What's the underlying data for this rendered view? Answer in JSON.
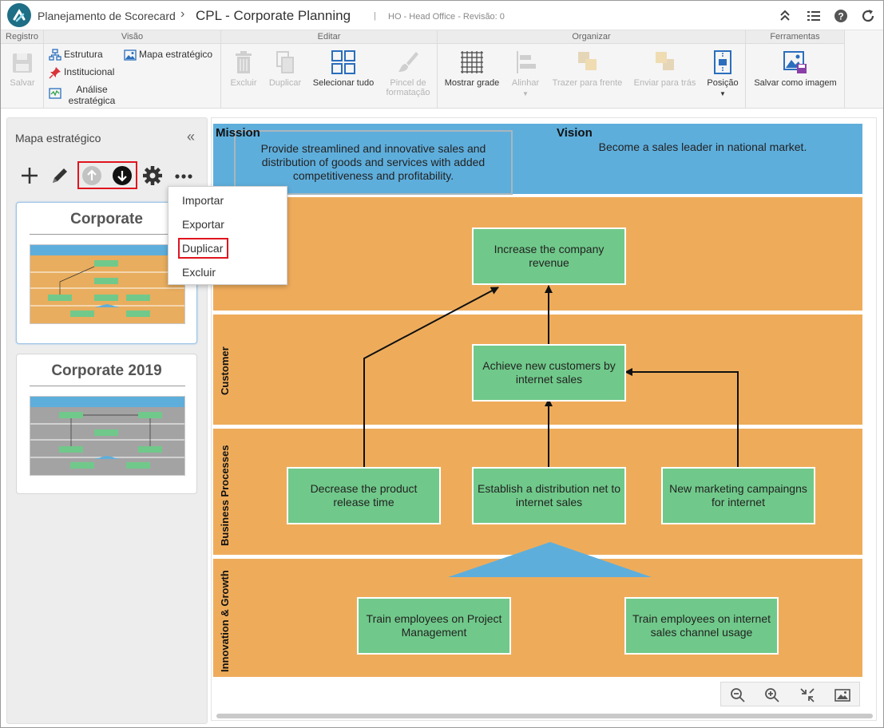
{
  "header": {
    "app_title": "Planejamento de Scorecard",
    "separator": "›",
    "page_title": "CPL - Corporate Planning",
    "meta_separator": "|",
    "meta": "HO - Head Office - Revisão: 0",
    "icons": [
      "collapse-up-icon",
      "list-icon",
      "help-icon",
      "refresh-icon"
    ]
  },
  "ribbon": {
    "groups": {
      "registro": "Registro",
      "visao": "Visão",
      "editar": "Editar",
      "organizar": "Organizar",
      "ferramentas": "Ferramentas"
    },
    "buttons": {
      "salvar": "Salvar",
      "estrutura": "Estrutura",
      "institucional": "Institucional",
      "analise_line1": "Análise",
      "analise_line2": "estratégica",
      "mapa": "Mapa estratégico",
      "excluir": "Excluir",
      "duplicar": "Duplicar",
      "selecionar": "Selecionar tudo",
      "pincel_line1": "Pincel de",
      "pincel_line2": "formatação",
      "mostrar": "Mostrar grade",
      "alinhar": "Alinhar",
      "trazer": "Trazer para frente",
      "enviar": "Enviar para trás",
      "posicao": "Posição",
      "salvar_imagem": "Salvar como imagem"
    }
  },
  "left_panel": {
    "title": "Mapa estratégico",
    "collapse": "«",
    "cards": [
      {
        "title": "Corporate"
      },
      {
        "title": "Corporate 2019"
      }
    ]
  },
  "menu": {
    "items": [
      "Importar",
      "Exportar",
      "Duplicar",
      "Excluir"
    ]
  },
  "map": {
    "mission_label": "Mission",
    "mission_text": "Provide streamlined and innovative sales and distribution of goods and services with added competitiveness and profitability.",
    "vision_label": "Vision",
    "vision_text": "Become a sales leader in national market.",
    "perspectives": [
      "Customer",
      "Business Processes",
      "Innovation & Growth"
    ],
    "objectives": {
      "revenue": "Increase the company revenue",
      "customers": "Achieve new customers by internet sales",
      "release": "Decrease the product release time",
      "distribution": "Establish a distribution net to internet sales",
      "marketing": "New marketing campaingns for internet",
      "train_pm": "Train employees on Project Management",
      "train_internet": "Train employees on internet sales channel usage"
    },
    "colors": {
      "mission_band": "#5eaedc",
      "perspective_band": "#eeac5b",
      "objective": "#70c98a",
      "highlight": "#e0141e"
    }
  }
}
